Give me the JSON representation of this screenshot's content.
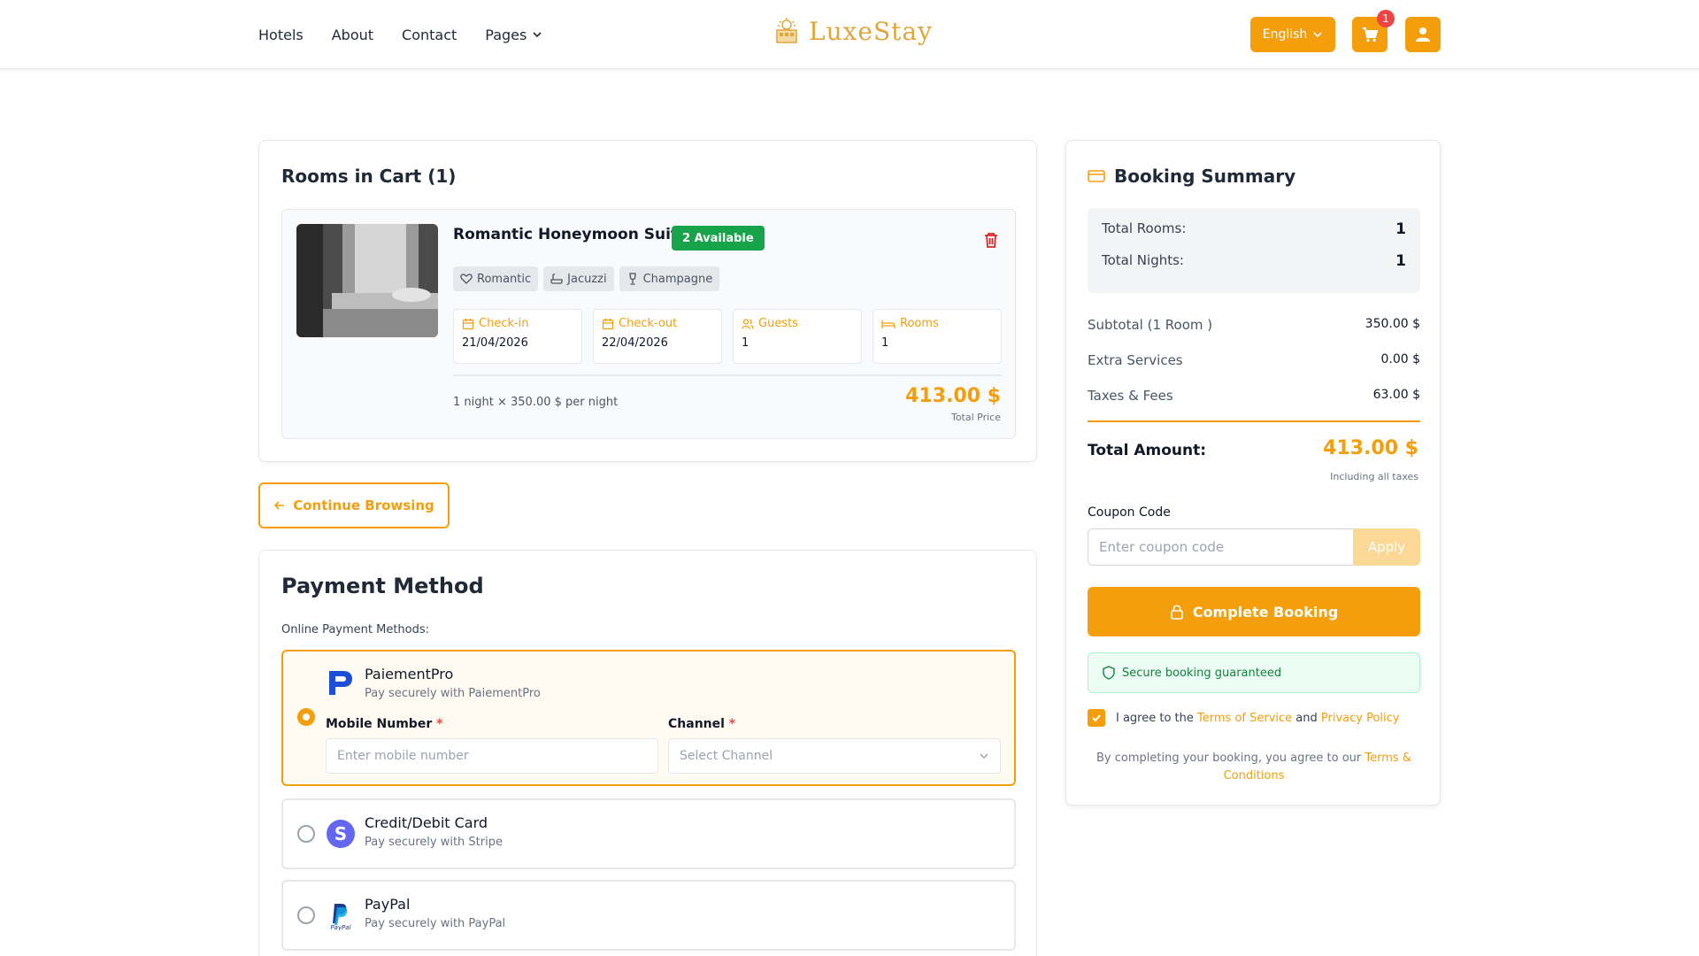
{
  "nav": {
    "items": [
      "Hotels",
      "About",
      "Contact"
    ],
    "pages_label": "Pages"
  },
  "brand": {
    "name": "LuxeStay",
    "color": "#e0a63c"
  },
  "header": {
    "language": "English",
    "cart_count": "1",
    "accent": "#f59e0b"
  },
  "cart": {
    "title": "Rooms in Cart (1)",
    "room": {
      "name": "Romantic Honeymoon Suite",
      "availability": "2 Available",
      "tags": [
        "Romantic",
        "Jacuzzi",
        "Champagne"
      ],
      "checkin_label": "Check-in",
      "checkin": "21/04/2026",
      "checkout_label": "Check-out",
      "checkout": "22/04/2026",
      "guests_label": "Guests",
      "guests": "1",
      "rooms_label": "Rooms",
      "rooms": "1",
      "per_night": "1 night × 350.00 $ per night",
      "total": "413.00 $",
      "total_label": "Total Price"
    },
    "continue_label": "Continue Browsing"
  },
  "payment": {
    "title": "Payment Method",
    "online_label": "Online Payment Methods:",
    "methods": [
      {
        "name": "PaiementPro",
        "sub": "Pay securely with PaiementPro",
        "selected": true
      },
      {
        "name": "Credit/Debit Card",
        "sub": "Pay securely with Stripe",
        "selected": false
      },
      {
        "name": "PayPal",
        "sub": "Pay securely with PayPal",
        "selected": false
      }
    ],
    "mobile_label": "Mobile Number",
    "mobile_placeholder": "Enter mobile number",
    "channel_label": "Channel",
    "channel_placeholder": "Select Channel",
    "required_mark": "*"
  },
  "summary": {
    "title": "Booking Summary",
    "total_rooms_label": "Total Rooms:",
    "total_rooms": "1",
    "total_nights_label": "Total Nights:",
    "total_nights": "1",
    "subtotal_label": "Subtotal (1 Room )",
    "subtotal": "350.00 $",
    "extra_label": "Extra Services",
    "extra": "0.00 $",
    "taxes_label": "Taxes & Fees",
    "taxes": "63.00 $",
    "total_label": "Total Amount:",
    "total": "413.00 $",
    "total_sub": "Including all taxes",
    "coupon_label": "Coupon Code",
    "coupon_placeholder": "Enter coupon code",
    "apply_label": "Apply",
    "complete_label": "Complete Booking",
    "secure_label": "Secure booking guaranteed",
    "agree_prefix": "I agree to the",
    "terms_of_service": "Terms of Service",
    "and": "and",
    "privacy_policy": "Privacy Policy",
    "note_prefix": "By completing your booking, you agree to our",
    "note_link": "Terms & Conditions"
  }
}
